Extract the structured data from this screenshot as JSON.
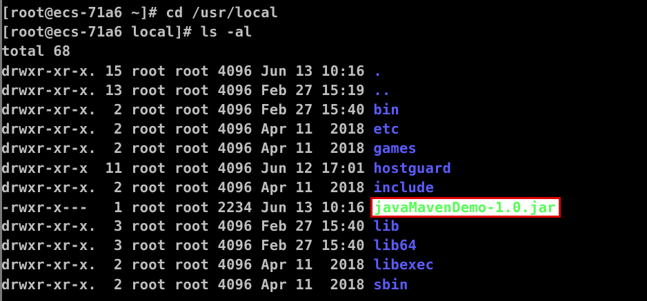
{
  "terminal": {
    "lines": [
      {
        "kind": "prompt",
        "text": "[root@ecs-71a6 ~]# cd /usr/local"
      },
      {
        "kind": "prompt",
        "text": "[root@ecs-71a6 local]# ls -al"
      },
      {
        "kind": "plain",
        "text": "total 68"
      },
      {
        "kind": "entry",
        "prefix": "drwxr-xr-x. 15 root root 4096 Jun 13 10:16 ",
        "name": ".",
        "type": "dir"
      },
      {
        "kind": "entry",
        "prefix": "drwxr-xr-x. 13 root root 4096 Feb 27 15:19 ",
        "name": "..",
        "type": "dir"
      },
      {
        "kind": "entry",
        "prefix": "drwxr-xr-x.  2 root root 4096 Feb 27 15:40 ",
        "name": "bin",
        "type": "dir"
      },
      {
        "kind": "entry",
        "prefix": "drwxr-xr-x.  2 root root 4096 Apr 11  2018 ",
        "name": "etc",
        "type": "dir"
      },
      {
        "kind": "entry",
        "prefix": "drwxr-xr-x.  2 root root 4096 Apr 11  2018 ",
        "name": "games",
        "type": "dir"
      },
      {
        "kind": "entry",
        "prefix": "drwxr-xr-x  11 root root 4096 Jun 12 17:01 ",
        "name": "hostguard",
        "type": "dir"
      },
      {
        "kind": "entry",
        "prefix": "drwxr-xr-x.  2 root root 4096 Apr 11  2018 ",
        "name": "include",
        "type": "dir"
      },
      {
        "kind": "entry",
        "prefix": "-rwxr-x---   1 root root 2234 Jun 13 10:16 ",
        "name": "javaMavenDemo-1.0.jar",
        "type": "exec"
      },
      {
        "kind": "entry",
        "prefix": "drwxr-xr-x.  3 root root 4096 Feb 27 15:40 ",
        "name": "lib",
        "type": "dir"
      },
      {
        "kind": "entry",
        "prefix": "drwxr-xr-x.  3 root root 4096 Feb 27 15:40 ",
        "name": "lib64",
        "type": "dir"
      },
      {
        "kind": "entry",
        "prefix": "drwxr-xr-x.  2 root root 4096 Apr 11  2018 ",
        "name": "libexec",
        "type": "dir"
      },
      {
        "kind": "entry",
        "prefix": "drwxr-xr-x.  2 root root 4096 Apr 11  2018 ",
        "name": "sbin",
        "type": "dir"
      }
    ]
  },
  "colors": {
    "background": "#000000",
    "text": "#bfbfbf",
    "directory": "#5c5cff",
    "executable": "#54ff54",
    "highlight_box": "#e00000"
  }
}
